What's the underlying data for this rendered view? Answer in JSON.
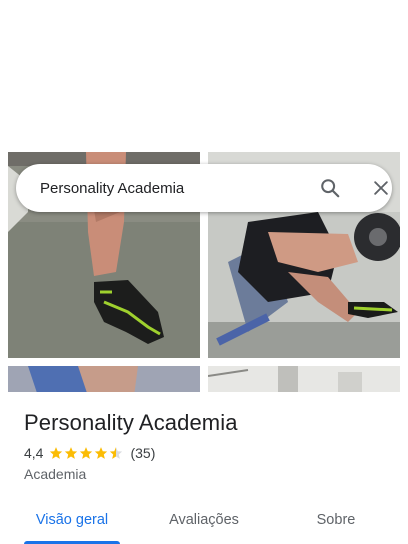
{
  "search": {
    "value": "Personality Academia",
    "icons": {
      "search": "search-icon",
      "close": "close-icon"
    }
  },
  "photos": [
    {
      "name": "photo-gym-shoes"
    },
    {
      "name": "photo-gym-curl"
    },
    {
      "name": "photo-gym-3"
    },
    {
      "name": "photo-gym-4"
    }
  ],
  "place": {
    "title": "Personality Academia",
    "rating": "4,4",
    "rating_stars": 4.4,
    "review_count": "(35)",
    "category": "Academia"
  },
  "tabs": [
    {
      "label": "Visão geral",
      "active": true
    },
    {
      "label": "Avaliações",
      "active": false
    },
    {
      "label": "Sobre",
      "active": false
    }
  ],
  "colors": {
    "accent": "#1a73e8",
    "star": "#fbbc04",
    "text": "#202124",
    "secondary": "#5f6368"
  }
}
